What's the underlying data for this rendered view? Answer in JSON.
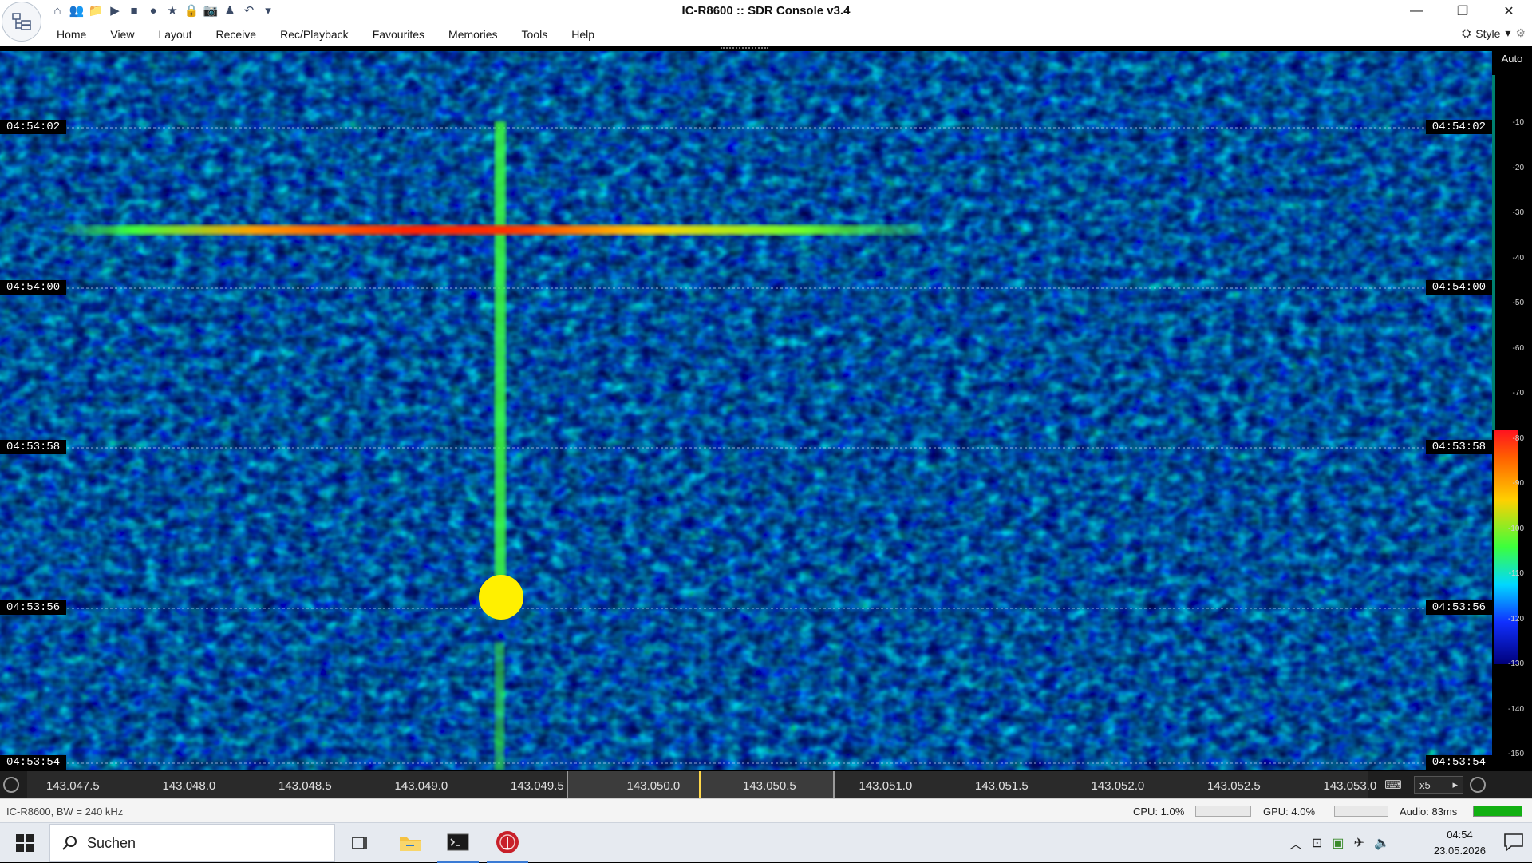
{
  "window": {
    "title": "IC-R8600 :: SDR Console v3.4"
  },
  "quick_access": [
    {
      "icon": "home-icon",
      "glyph": "⌂"
    },
    {
      "icon": "users-icon",
      "glyph": "👥"
    },
    {
      "icon": "folder-icon",
      "glyph": "📁"
    },
    {
      "icon": "play-icon",
      "glyph": "▶"
    },
    {
      "icon": "stop-icon",
      "glyph": "■"
    },
    {
      "icon": "record-icon",
      "glyph": "●"
    },
    {
      "icon": "star-icon",
      "glyph": "★"
    },
    {
      "icon": "lock-icon",
      "glyph": "🔒"
    },
    {
      "icon": "camera-icon",
      "glyph": "📷"
    },
    {
      "icon": "person-icon",
      "glyph": "♟"
    },
    {
      "icon": "undo-icon",
      "glyph": "↶"
    },
    {
      "icon": "dropdown-icon",
      "glyph": "▾"
    }
  ],
  "menus": [
    "Home",
    "View",
    "Layout",
    "Receive",
    "Rec/Playback",
    "Favourites",
    "Memories",
    "Tools",
    "Help"
  ],
  "style_label": "Style",
  "waterfall": {
    "time_labels": [
      "04:54:02",
      "04:54:00",
      "04:53:58",
      "04:53:56",
      "04:53:54"
    ],
    "colors": {
      "deep": "#00006a",
      "blue": "#0a3cff",
      "cyan": "#00e0ff",
      "green": "#3cff3c",
      "yellow": "#ffee00",
      "red": "#ff2000",
      "marker": "#fff000"
    }
  },
  "scale": {
    "auto_label": "Auto",
    "levels": [
      "-10",
      "-20",
      "-30",
      "-40",
      "-50",
      "-60",
      "-70",
      "-80",
      "-90",
      "-100",
      "-110",
      "-120",
      "-130",
      "-140",
      "-150"
    ]
  },
  "frequency_axis": {
    "labels": [
      "143.047.5",
      "143.048.0",
      "143.048.5",
      "143.049.0",
      "143.049.5",
      "143.050.0",
      "143.050.5",
      "143.051.0",
      "143.051.5",
      "143.052.0",
      "143.052.5",
      "143.053.0"
    ],
    "zoom": "x5"
  },
  "status": {
    "radio": "IC-R8600, BW = 240 kHz",
    "cpu": "CPU: 1.0%",
    "gpu": "GPU: 4.0%",
    "audio": "Audio: 83ms"
  },
  "taskbar": {
    "search_placeholder": "Suchen",
    "time": "04:54",
    "date": "23.05.2026"
  }
}
